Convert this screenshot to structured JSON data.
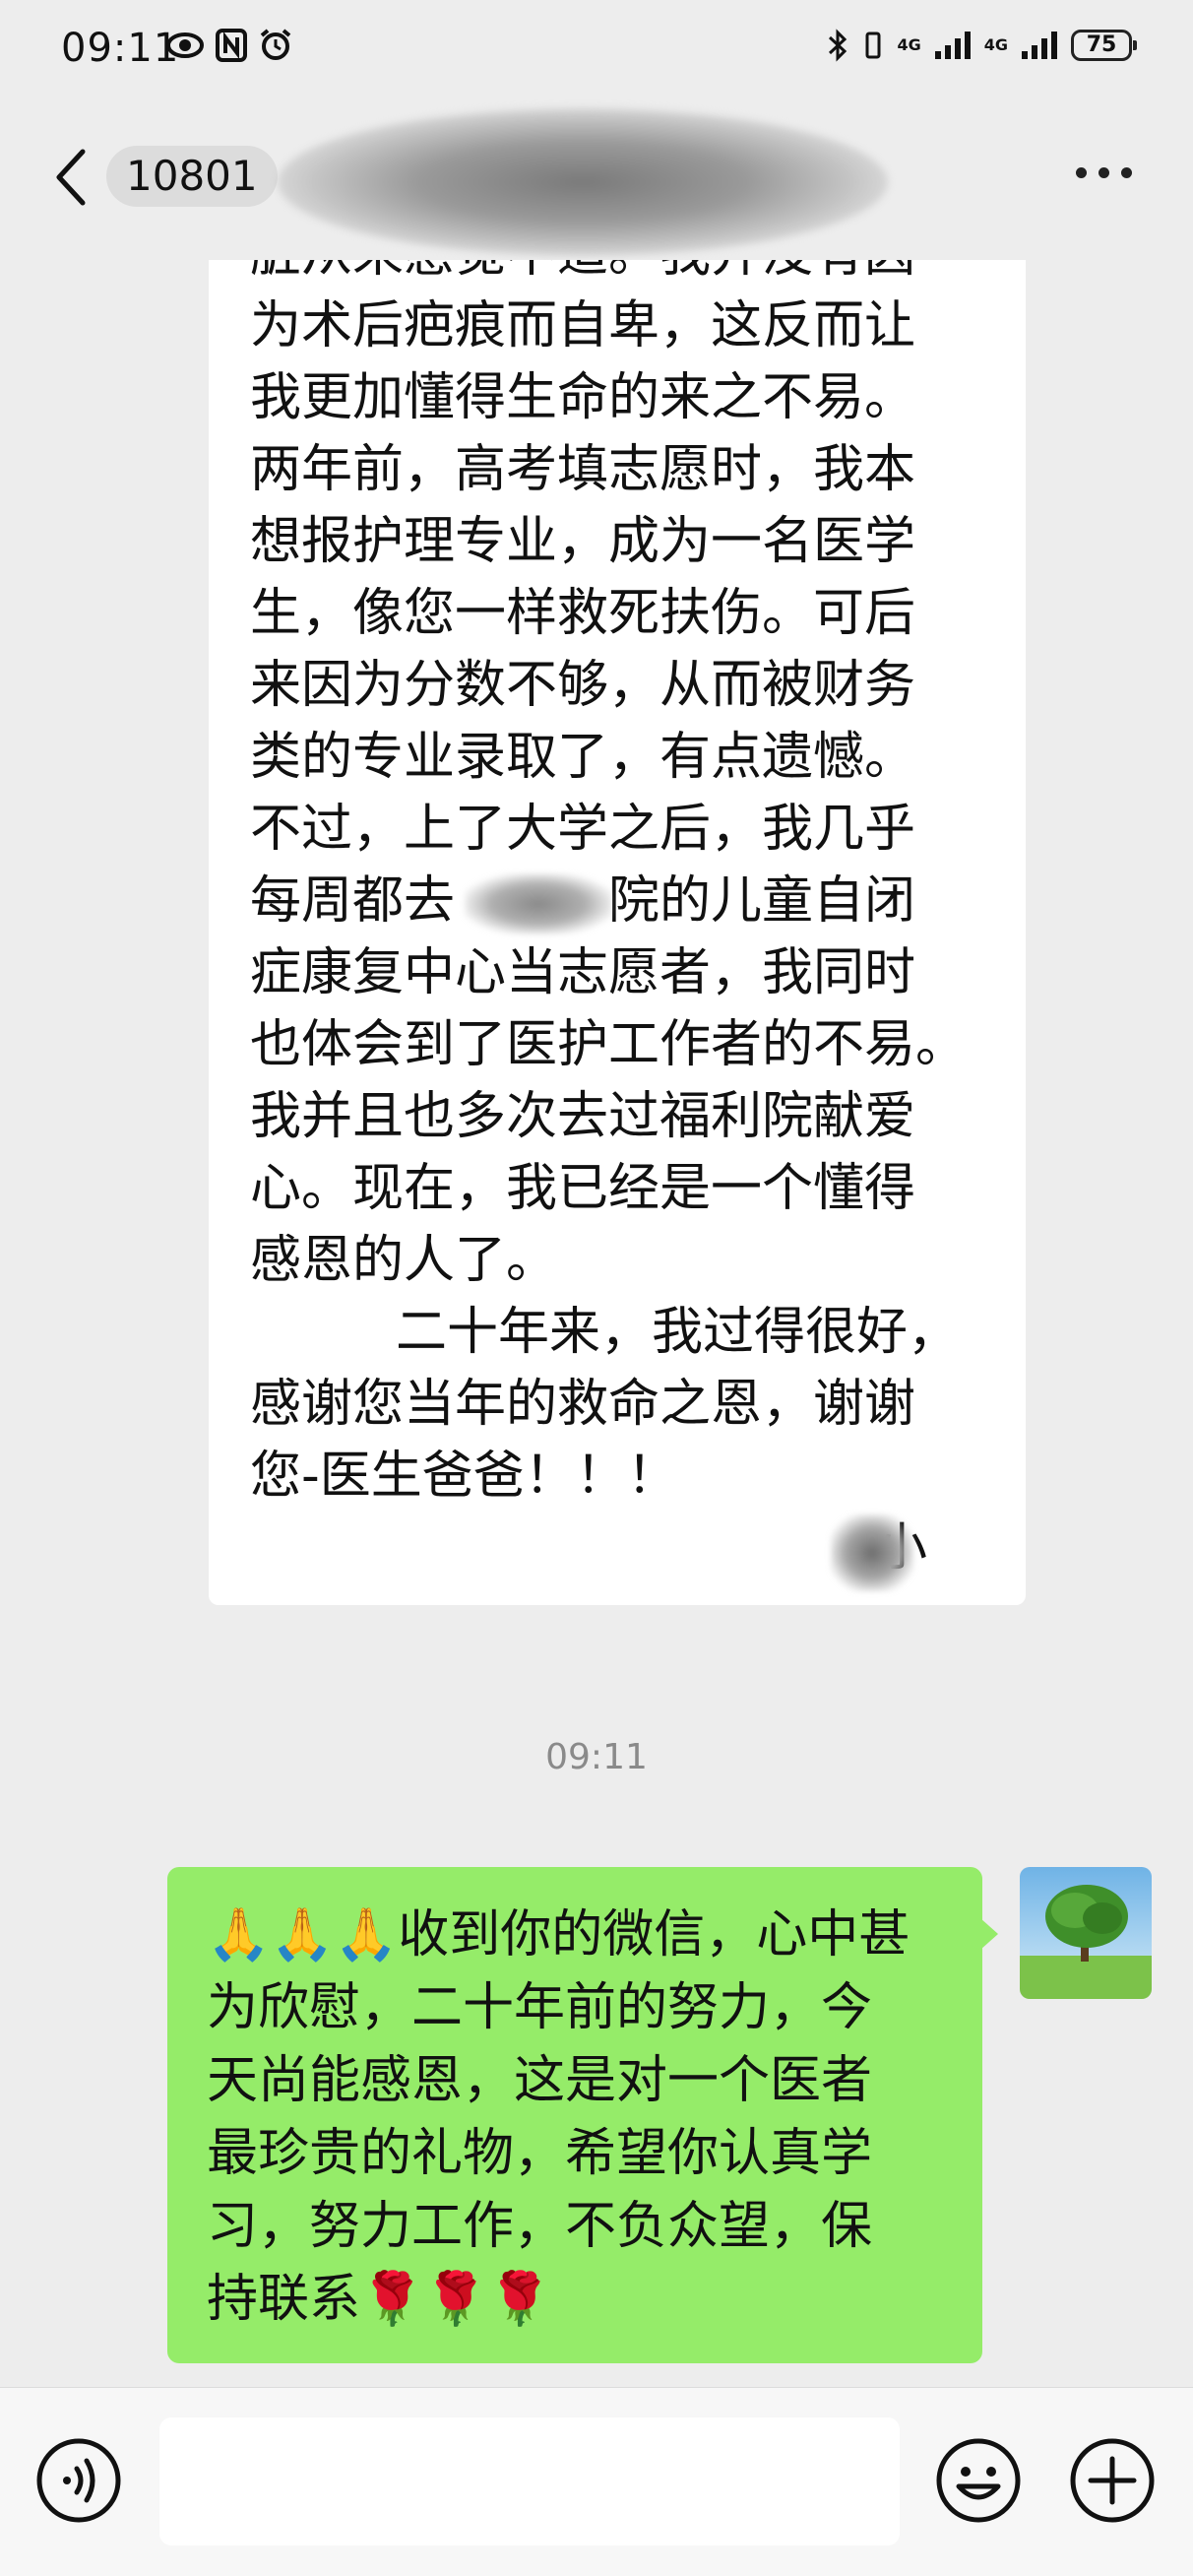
{
  "status_bar": {
    "time": "09:11",
    "signal_1": "4G",
    "signal_2": "4G",
    "battery": "75"
  },
  "header": {
    "title": "10801"
  },
  "letter": {
    "lines": [
      "脏从来感觉不适。我并没有因",
      "为术后疤痕而自卑，这反而让",
      "我更加懂得生命的来之不易。",
      "两年前，高考填志愿时，我本",
      "想报护理专业，成为一名医学",
      "生，像您一样救死扶伤。可后",
      "来因为分数不够，从而被财务",
      "类的专业录取了，有点遗憾。",
      "不过，上了大学之后，我几乎",
      "每周都去　　　院的儿童自闭",
      "症康复中心当志愿者，我同时",
      "也体会到了医护工作者的不易。",
      "我并且也多次去过福利院献爱",
      "心。现在，我已经是一个懂得",
      "感恩的人了。",
      "二十年来，我过得很好，",
      "感谢您当年的救命之恩，谢谢",
      "您-医生爸爸！！！",
      "-小　"
    ]
  },
  "timestamp": "09:11",
  "reply": {
    "lines": [
      "收到你的微信，心中甚",
      "为欣慰，二十年前的努力，今",
      "天尚能感恩，这是对一个医者",
      "最珍贵的礼物，希望你认真学",
      "习，努力工作，不负众望，保",
      "持联系"
    ],
    "leading_emoji": "🙏🙏🙏",
    "trailing_emoji": "🌹🌹🌹"
  },
  "input": {
    "placeholder": ""
  },
  "icons": {
    "back": "chevron-left-icon",
    "more": "more-dots-icon",
    "voice": "voice-icon",
    "emoji": "emoji-icon",
    "plus": "plus-icon"
  },
  "colors": {
    "background": "#ededed",
    "incoming_bubble": "#ffffff",
    "outgoing_bubble": "#95ec69",
    "timestamp": "#8a8a8a"
  }
}
